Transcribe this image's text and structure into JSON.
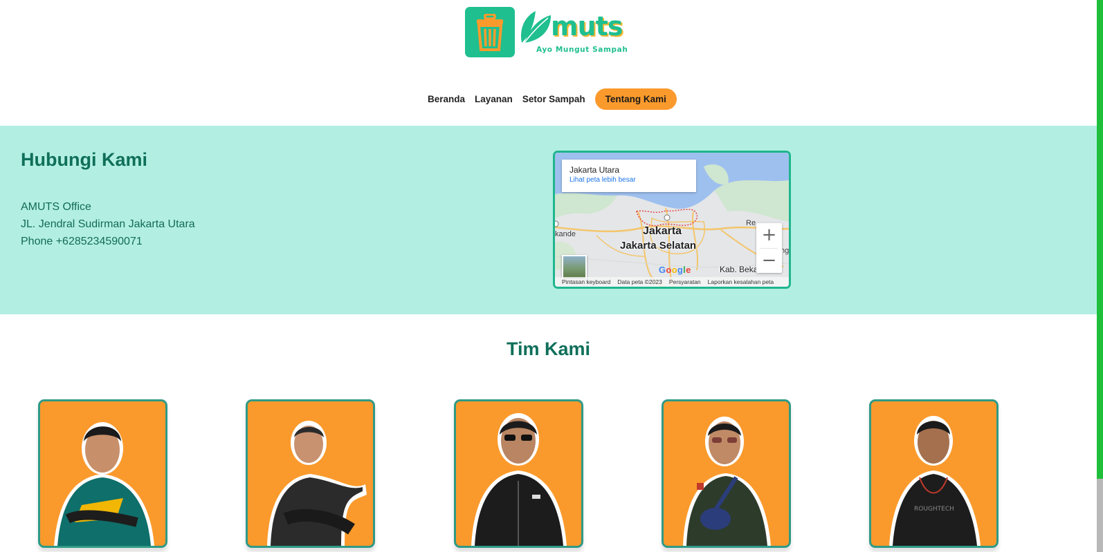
{
  "header": {
    "brand": "muts",
    "tagline": "Ayo Mungut Sampah",
    "nav": [
      {
        "label": "Beranda"
      },
      {
        "label": "Layanan"
      },
      {
        "label": "Setor Sampah"
      },
      {
        "label": "Tentang Kami",
        "active": true
      }
    ]
  },
  "contact": {
    "title": "Hubungi Kami",
    "office": "AMUTS Office",
    "address": "JL. Jendral Sudirman Jakarta Utara",
    "phone": "Phone +6285234590071"
  },
  "map": {
    "place": "Jakarta Utara",
    "larger_map": "Lihat peta lebih besar",
    "labels": [
      "Jakarta",
      "Jakarta Selatan",
      "Kab. Bekasi",
      "kande",
      "Re",
      "ng"
    ],
    "zoom_in": "+",
    "zoom_out": "−",
    "google": "Google",
    "footer": [
      "Pintasan keyboard",
      "Data peta ©2023",
      "Persyaratan",
      "Laporkan kesalahan peta"
    ]
  },
  "team": {
    "title": "Tim Kami",
    "members": [
      {
        "jacket": "#0f6f6a",
        "accent": "#f2b705"
      },
      {
        "jacket": "#2b2b2b",
        "accent": "#3a3a3a"
      },
      {
        "jacket": "#1c1c1c",
        "accent": "#2a2a2a"
      },
      {
        "jacket": "#2d3b2b",
        "accent": "#2b3d7a"
      },
      {
        "jacket": "#1d1d1d",
        "accent": "#c0392b"
      }
    ]
  },
  "colors": {
    "brand_green": "#1fbf8f",
    "accent_orange": "#fb9a2c",
    "band_mint": "#b2efe2",
    "heading_teal": "#0f6f5a"
  }
}
